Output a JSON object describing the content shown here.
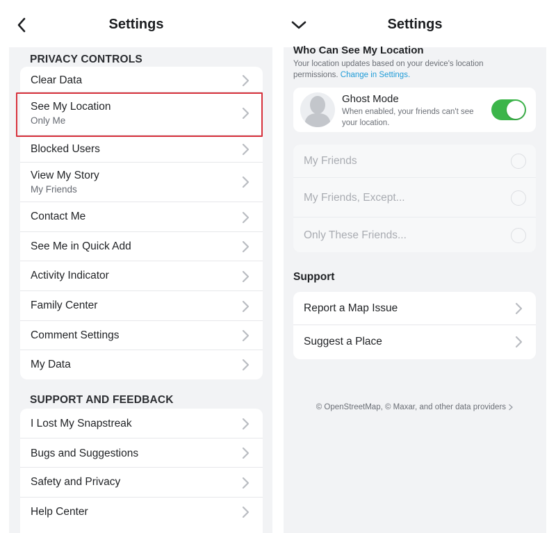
{
  "left": {
    "header": {
      "title": "Settings",
      "back_icon": "chevron-left-icon"
    },
    "privacy": {
      "title": "PRIVACY CONTROLS",
      "items": [
        {
          "label": "Clear Data",
          "sub": ""
        },
        {
          "label": "See My Location",
          "sub": "Only Me"
        },
        {
          "label": "Blocked Users",
          "sub": ""
        },
        {
          "label": "View My Story",
          "sub": "My Friends"
        },
        {
          "label": "Contact Me",
          "sub": ""
        },
        {
          "label": "See Me in Quick Add",
          "sub": ""
        },
        {
          "label": "Activity Indicator",
          "sub": ""
        },
        {
          "label": "Family Center",
          "sub": ""
        },
        {
          "label": "Comment Settings",
          "sub": ""
        },
        {
          "label": "My Data",
          "sub": ""
        }
      ]
    },
    "support": {
      "title": "SUPPORT AND FEEDBACK",
      "items": [
        {
          "label": "I Lost My Snapstreak"
        },
        {
          "label": "Bugs and Suggestions"
        },
        {
          "label": "Safety and Privacy"
        },
        {
          "label": "Help Center"
        }
      ]
    },
    "highlight_color": "#d7303b"
  },
  "right": {
    "header": {
      "title": "Settings",
      "collapse_icon": "chevron-down-icon"
    },
    "location": {
      "heading": "Who Can See My Location",
      "description": "Your location updates based on your device's location permissions.",
      "link": "Change in Settings."
    },
    "ghost_mode": {
      "title": "Ghost Mode",
      "description": "When enabled, your friends can't see your location.",
      "enabled": true,
      "toggle_color": "#3cb54a"
    },
    "options": [
      {
        "label": "My Friends"
      },
      {
        "label": "My Friends, Except..."
      },
      {
        "label": "Only These Friends..."
      }
    ],
    "support": {
      "title": "Support",
      "items": [
        {
          "label": "Report a Map Issue"
        },
        {
          "label": "Suggest a Place"
        }
      ]
    },
    "attribution": "© OpenStreetMap, © Maxar, and other data providers"
  }
}
